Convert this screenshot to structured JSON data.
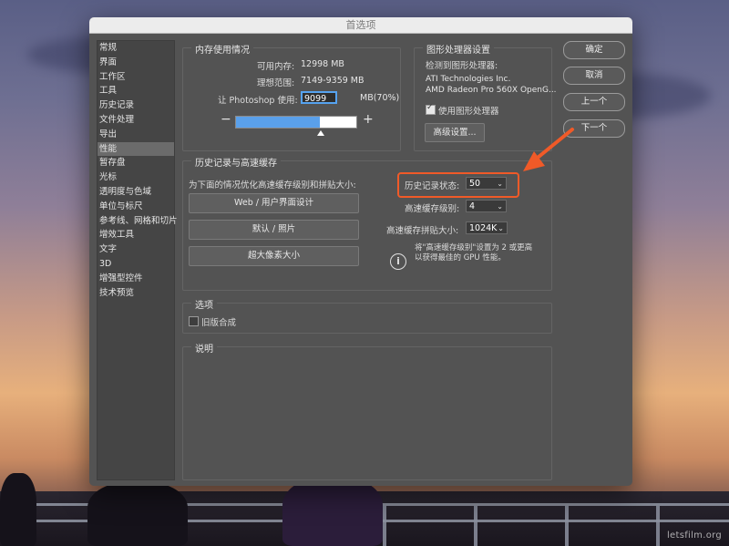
{
  "window": {
    "title": "首选项"
  },
  "sidebar": {
    "items": [
      {
        "label": "常规",
        "active": false
      },
      {
        "label": "界面",
        "active": false
      },
      {
        "label": "工作区",
        "active": false
      },
      {
        "label": "工具",
        "active": false
      },
      {
        "label": "历史记录",
        "active": false
      },
      {
        "label": "文件处理",
        "active": false
      },
      {
        "label": "导出",
        "active": false
      },
      {
        "label": "性能",
        "active": true
      },
      {
        "label": "暂存盘",
        "active": false
      },
      {
        "label": "光标",
        "active": false
      },
      {
        "label": "透明度与色域",
        "active": false
      },
      {
        "label": "单位与标尺",
        "active": false
      },
      {
        "label": "参考线、网格和切片",
        "active": false
      },
      {
        "label": "增效工具",
        "active": false
      },
      {
        "label": "文字",
        "active": false
      },
      {
        "label": "3D",
        "active": false
      },
      {
        "label": "增强型控件",
        "active": false
      },
      {
        "label": "技术预览",
        "active": false
      }
    ]
  },
  "memory": {
    "title": "内存使用情况",
    "available_label": "可用内存:",
    "available_value": "12998 MB",
    "ideal_label": "理想范围:",
    "ideal_value": "7149-9359 MB",
    "let_label": "让 Photoshop 使用:",
    "let_value": "9099",
    "let_unit": "MB(70%)",
    "usage_fraction": 0.7,
    "minus": "−",
    "plus": "+"
  },
  "gpu": {
    "title": "图形处理器设置",
    "detected_label": "检测到图形处理器:",
    "vendor": "ATI Technologies Inc.",
    "model": "AMD Radeon Pro 560X OpenG...",
    "use_gpu_label": "使用图形处理器",
    "use_gpu_checked": true,
    "advanced_button": "高级设置..."
  },
  "history_cache": {
    "title": "历史记录与高速缓存",
    "optimize_label": "为下面的情况优化高速缓存级别和拼贴大小:",
    "preset_buttons": [
      "Web / 用户界面设计",
      "默认 / 照片",
      "超大像素大小"
    ],
    "history_states_label": "历史记录状态:",
    "history_states_value": "50",
    "cache_levels_label": "高速缓存级别:",
    "cache_levels_value": "4",
    "tile_size_label": "高速缓存拼贴大小:",
    "tile_size_value": "1024K",
    "note": "将\"高速缓存级别\"设置为 2 或更高以获得最佳的 GPU 性能。",
    "note_line1": "将\"高速缓存级别\"设置为 2 或更高",
    "note_line2": "以获得最佳的 GPU 性能。"
  },
  "options": {
    "title": "选项",
    "legacy_compositing_label": "旧版合成",
    "legacy_compositing_checked": false
  },
  "description": {
    "title": "说明"
  },
  "actions": {
    "ok": "确定",
    "cancel": "取消",
    "prev": "上一个",
    "next": "下一个"
  },
  "watermark": "letsfilm.org",
  "colors": {
    "accent_highlight": "#f05a28",
    "slider_fill": "#5aa0ea",
    "dialog_bg": "#535353"
  }
}
